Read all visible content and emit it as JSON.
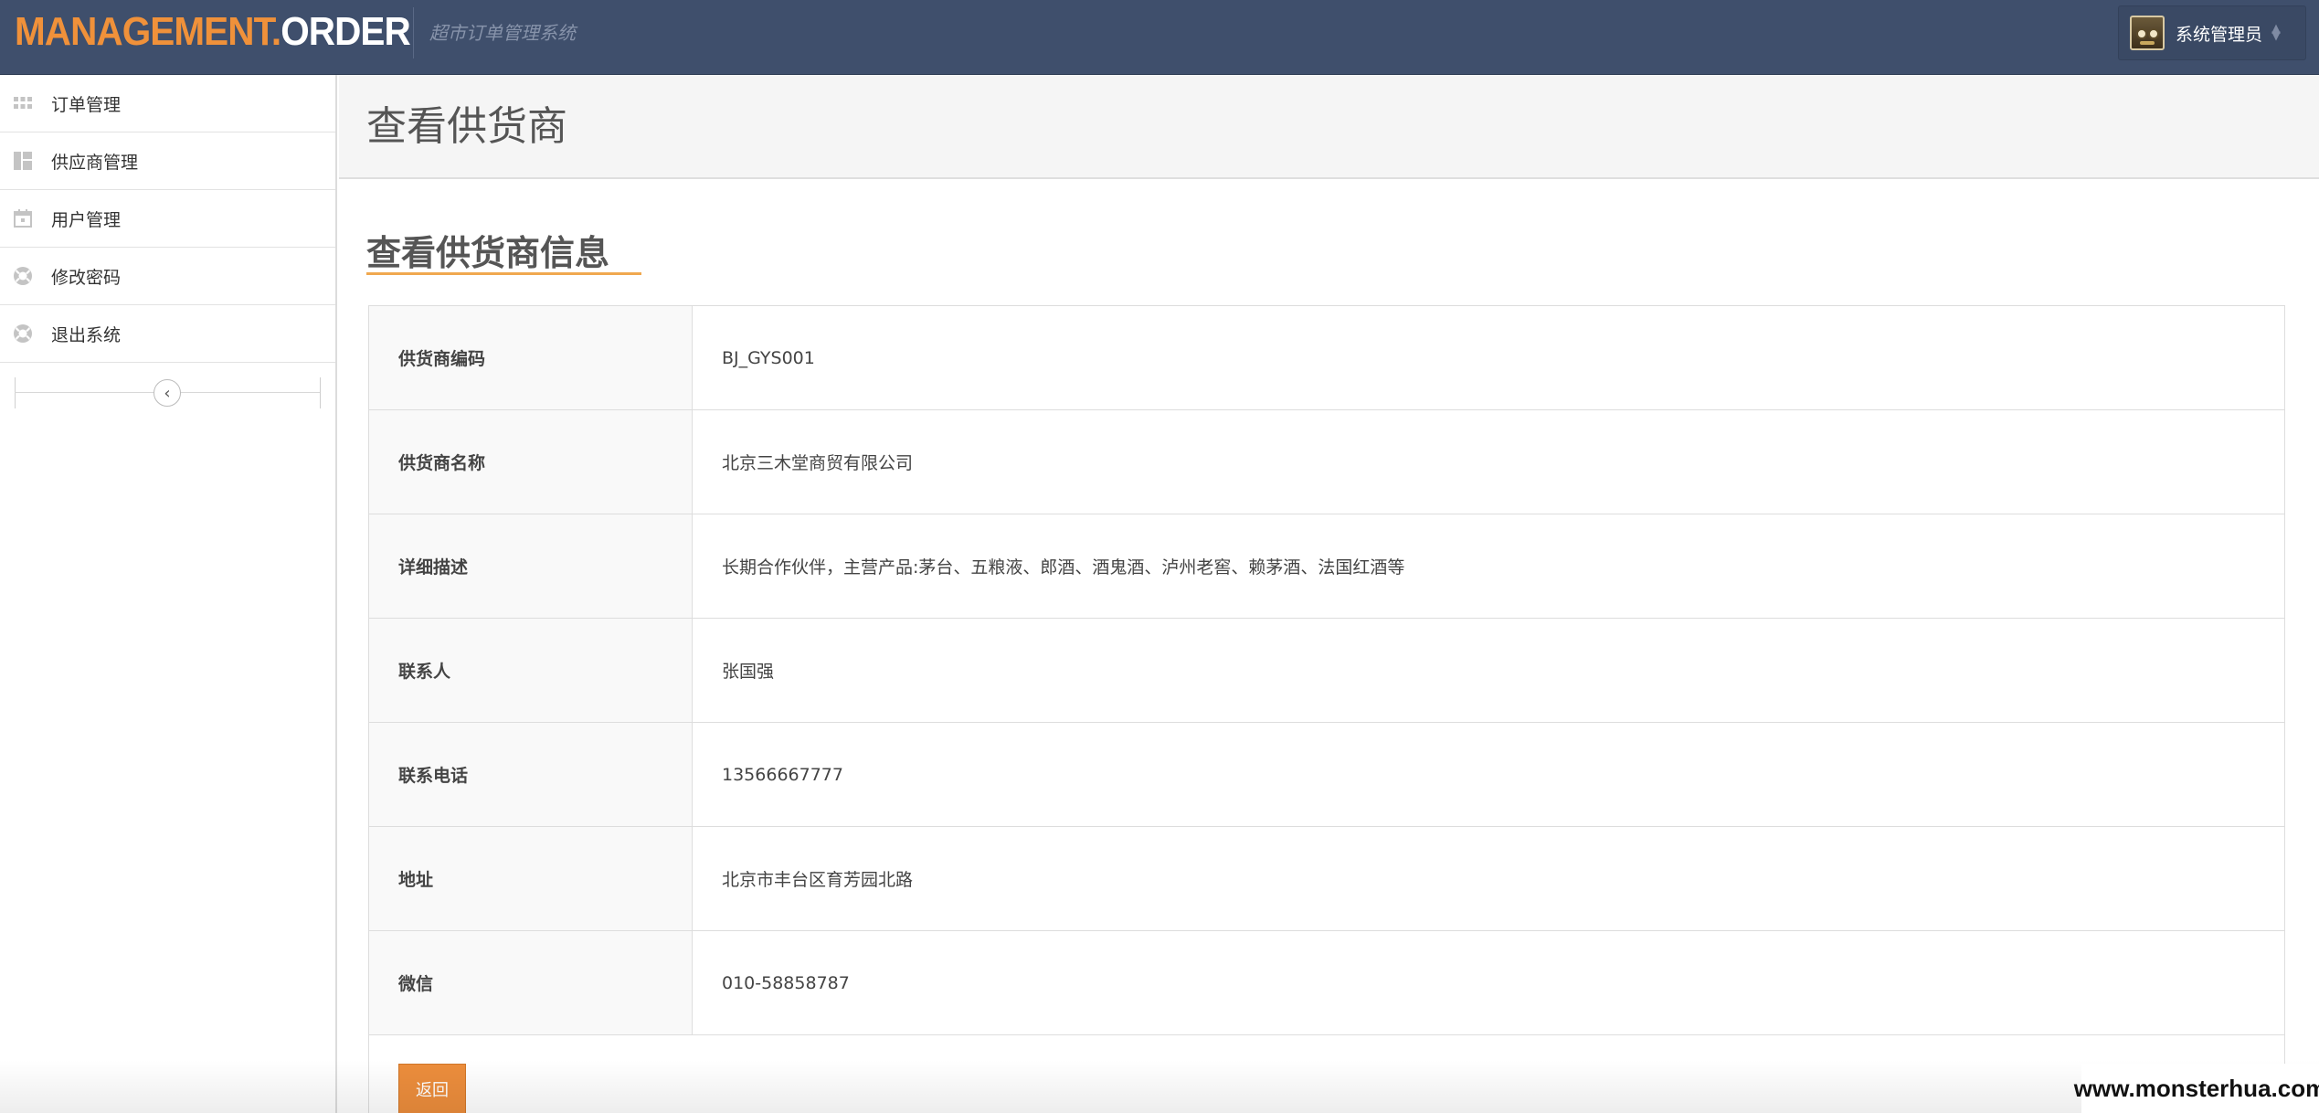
{
  "header": {
    "brand_part1": "MANAGEMENT.",
    "brand_part2": "ORDER",
    "subtitle": "超市订单管理系统",
    "user_name": "系统管理员",
    "colors": {
      "bar": "#3f4f6c",
      "brand_accent": "#f0913a"
    }
  },
  "sidebar": {
    "items": [
      {
        "label": "订单管理",
        "icon": "grid-icon"
      },
      {
        "label": "供应商管理",
        "icon": "dashboard-icon"
      },
      {
        "label": "用户管理",
        "icon": "calendar-icon"
      },
      {
        "label": "修改密码",
        "icon": "lifebuoy-icon"
      },
      {
        "label": "退出系统",
        "icon": "lifebuoy-icon"
      }
    ],
    "collapse_icon": "chevron-left-icon"
  },
  "page": {
    "title": "查看供货商",
    "section_title": "查看供货商信息"
  },
  "details": [
    {
      "label": "供货商编码",
      "value": "BJ_GYS001"
    },
    {
      "label": "供货商名称",
      "value": "北京三木堂商贸有限公司"
    },
    {
      "label": "详细描述",
      "value": "长期合作伙伴，主营产品:茅台、五粮液、郎酒、酒鬼酒、泸州老窖、赖茅酒、法国红酒等"
    },
    {
      "label": "联系人",
      "value": "张国强"
    },
    {
      "label": "联系电话",
      "value": "13566667777"
    },
    {
      "label": "地址",
      "value": "北京市丰台区育芳园北路"
    },
    {
      "label": "微信",
      "value": "010-58858787"
    }
  ],
  "actions": {
    "back_label": "返回",
    "back_color": "#ec8d3c"
  },
  "watermark": "www.monsterhua.com"
}
